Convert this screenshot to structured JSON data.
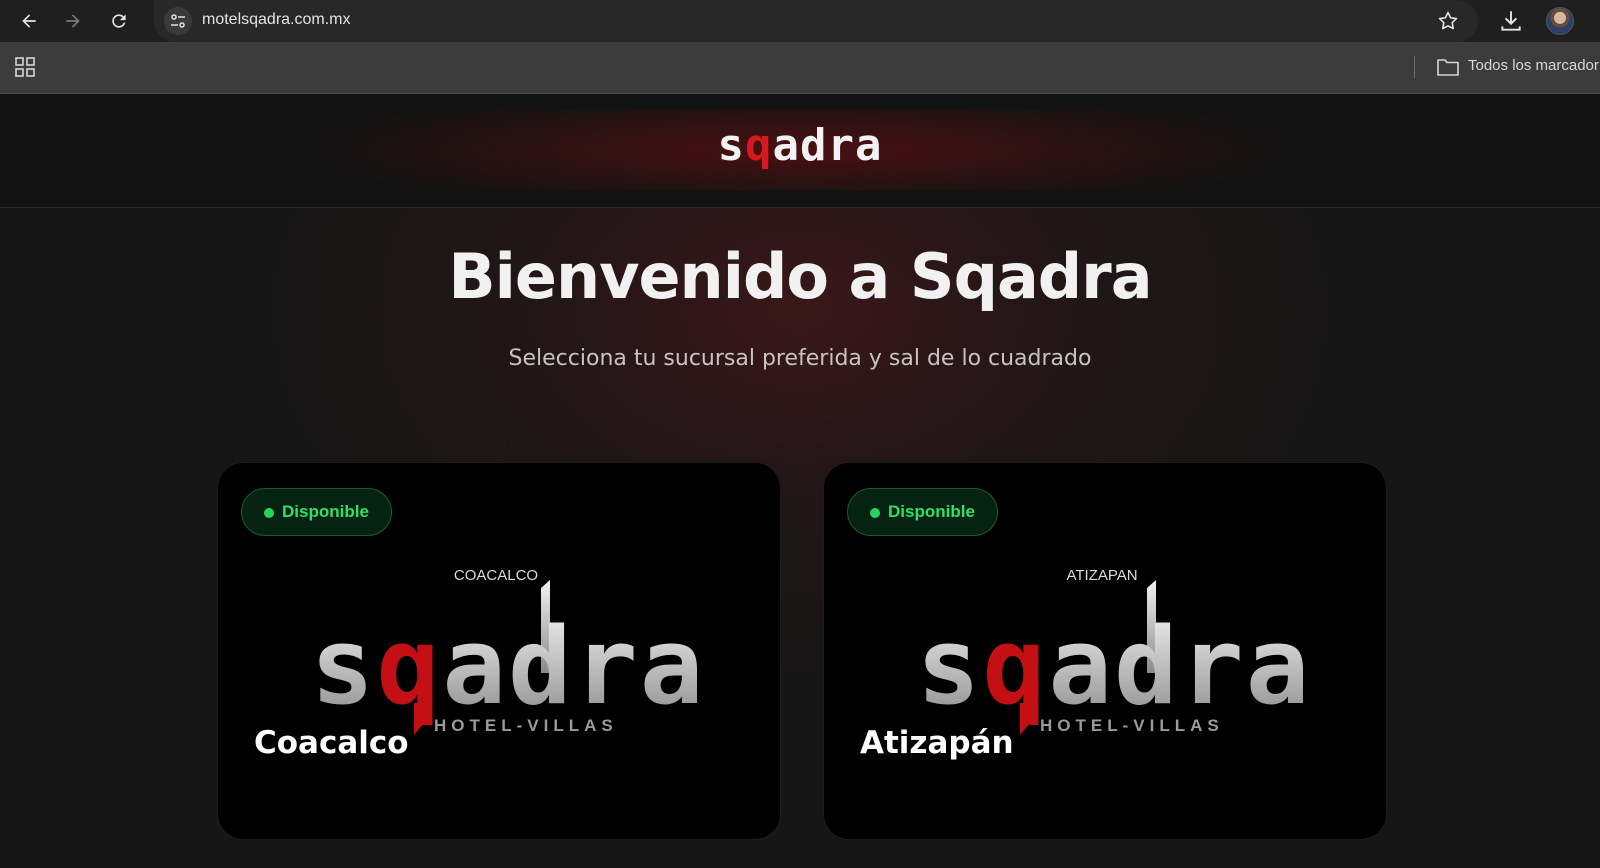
{
  "browser": {
    "url": "motelsqadra.com.mx",
    "bookmarks_label": "Todos los marcador",
    "icons": [
      "back-icon",
      "forward-icon",
      "reload-icon",
      "site-info-icon",
      "star-icon",
      "download-icon",
      "avatar",
      "apps-grid-icon",
      "folder-icon"
    ]
  },
  "header": {
    "brand_pre": "s",
    "brand_q": "q",
    "brand_post": "adra"
  },
  "hero": {
    "title": "Bienvenido a Sqadra",
    "subtitle": "Selecciona tu sucursal preferida y sal de lo cuadrado"
  },
  "branches": [
    {
      "status": "Disponible",
      "logo_location": "COACALCO",
      "logo_word_pre": "s",
      "logo_word_q": "q",
      "logo_word_post": "adra",
      "logo_tagline": "HOTEL-VILLAS",
      "name": "Coacalco"
    },
    {
      "status": "Disponible",
      "logo_location": "ATIZAPAN",
      "logo_word_pre": "s",
      "logo_word_q": "q",
      "logo_word_post": "adra",
      "logo_tagline": "HOTEL-VILLAS",
      "name": "Atizapán"
    }
  ],
  "colors": {
    "brand_red": "#d8181d",
    "status_green": "#2ee06a",
    "page_bg": "#171717"
  }
}
